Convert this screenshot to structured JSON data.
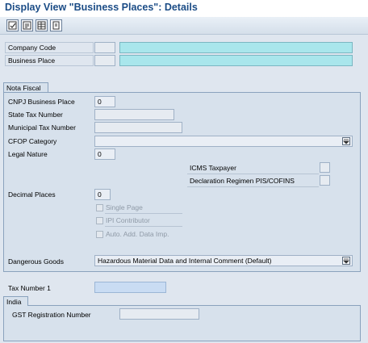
{
  "title": "Display View \"Business Places\": Details",
  "toolbar": {
    "buttons": [
      {
        "icon": "display-change-icon"
      },
      {
        "icon": "other-entry-icon"
      },
      {
        "icon": "table-view-icon"
      },
      {
        "icon": "print-icon"
      }
    ]
  },
  "header": {
    "company_code_label": "Company Code",
    "company_code_value": "",
    "company_code_desc": "",
    "business_place_label": "Business Place",
    "business_place_value": "",
    "business_place_desc": ""
  },
  "nota_fiscal": {
    "title": "Nota Fiscal",
    "cnpj_label": "CNPJ Business Place",
    "cnpj_value": "0",
    "state_tax_label": "State Tax Number",
    "state_tax_value": "",
    "municipal_tax_label": "Municipal Tax Number",
    "municipal_tax_value": "",
    "cfop_label": "CFOP Category",
    "cfop_value": "",
    "legal_nature_label": "Legal Nature",
    "legal_nature_value": "0",
    "icms_label": "ICMS Taxpayer",
    "declaration_label": "Declaration Regimen PIS/COFINS",
    "decimal_label": "Decimal Places",
    "decimal_value": "0",
    "single_page_label": "Single Page",
    "ipi_label": "IPI Contributor",
    "auto_add_label": "Auto. Add. Data Imp.",
    "dangerous_label": "Dangerous Goods",
    "dangerous_value": "Hazardous Material Data and Internal Comment (Default)"
  },
  "tax_number_1_label": "Tax Number 1",
  "tax_number_1_value": "",
  "india": {
    "title": "India",
    "gst_label": "GST Registration Number",
    "gst_value": ""
  }
}
